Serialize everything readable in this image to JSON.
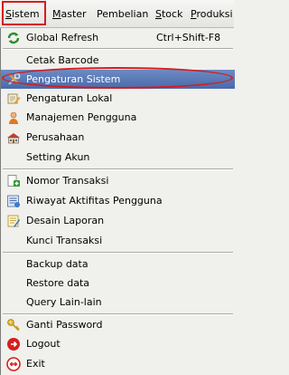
{
  "menubar": {
    "items": [
      {
        "label": "Sistem",
        "mnemonic": "S",
        "rest": "istem"
      },
      {
        "label": "Master",
        "mnemonic": "M",
        "rest": "aster"
      },
      {
        "label": "Pembelian",
        "mnemonic": "",
        "rest": "Pembelian"
      },
      {
        "label": "Stock",
        "mnemonic": "S",
        "rest": "tock"
      },
      {
        "label": "Produksi",
        "mnemonic": "P",
        "rest": "roduksi"
      }
    ]
  },
  "menu": {
    "global_refresh": {
      "label": "Global Refresh",
      "accel": "Ctrl+Shift-F8",
      "icon": "refresh-icon"
    },
    "cetak_barcode": {
      "label": "Cetak Barcode"
    },
    "pengaturan_sistem": {
      "label": "Pengaturan Sistem",
      "icon": "tools-icon"
    },
    "pengaturan_lokal": {
      "label": "Pengaturan Lokal",
      "icon": "pencil-icon"
    },
    "manajemen_pengguna": {
      "label": "Manajemen Pengguna",
      "icon": "user-icon"
    },
    "perusahaan": {
      "label": "Perusahaan",
      "icon": "building-icon"
    },
    "setting_akun": {
      "label": "Setting Akun"
    },
    "nomor_transaksi": {
      "label": "Nomor Transaksi",
      "icon": "add-document-icon"
    },
    "riwayat_aktifitas": {
      "label": "Riwayat Aktifitas Pengguna",
      "icon": "history-icon"
    },
    "desain_laporan": {
      "label": "Desain Laporan",
      "icon": "report-design-icon"
    },
    "kunci_transaksi": {
      "label": "Kunci Transaksi"
    },
    "backup_data": {
      "label": "Backup data"
    },
    "restore_data": {
      "label": "Restore data"
    },
    "query_lain": {
      "label": "Query Lain-lain"
    },
    "ganti_password": {
      "label": "Ganti Password",
      "icon": "key-icon"
    },
    "logout": {
      "label": "Logout",
      "icon": "logout-icon"
    },
    "exit": {
      "label": "Exit",
      "icon": "exit-icon"
    }
  },
  "colors": {
    "selected_background": "#5577b8",
    "annotation_red": "#d51c1c"
  }
}
